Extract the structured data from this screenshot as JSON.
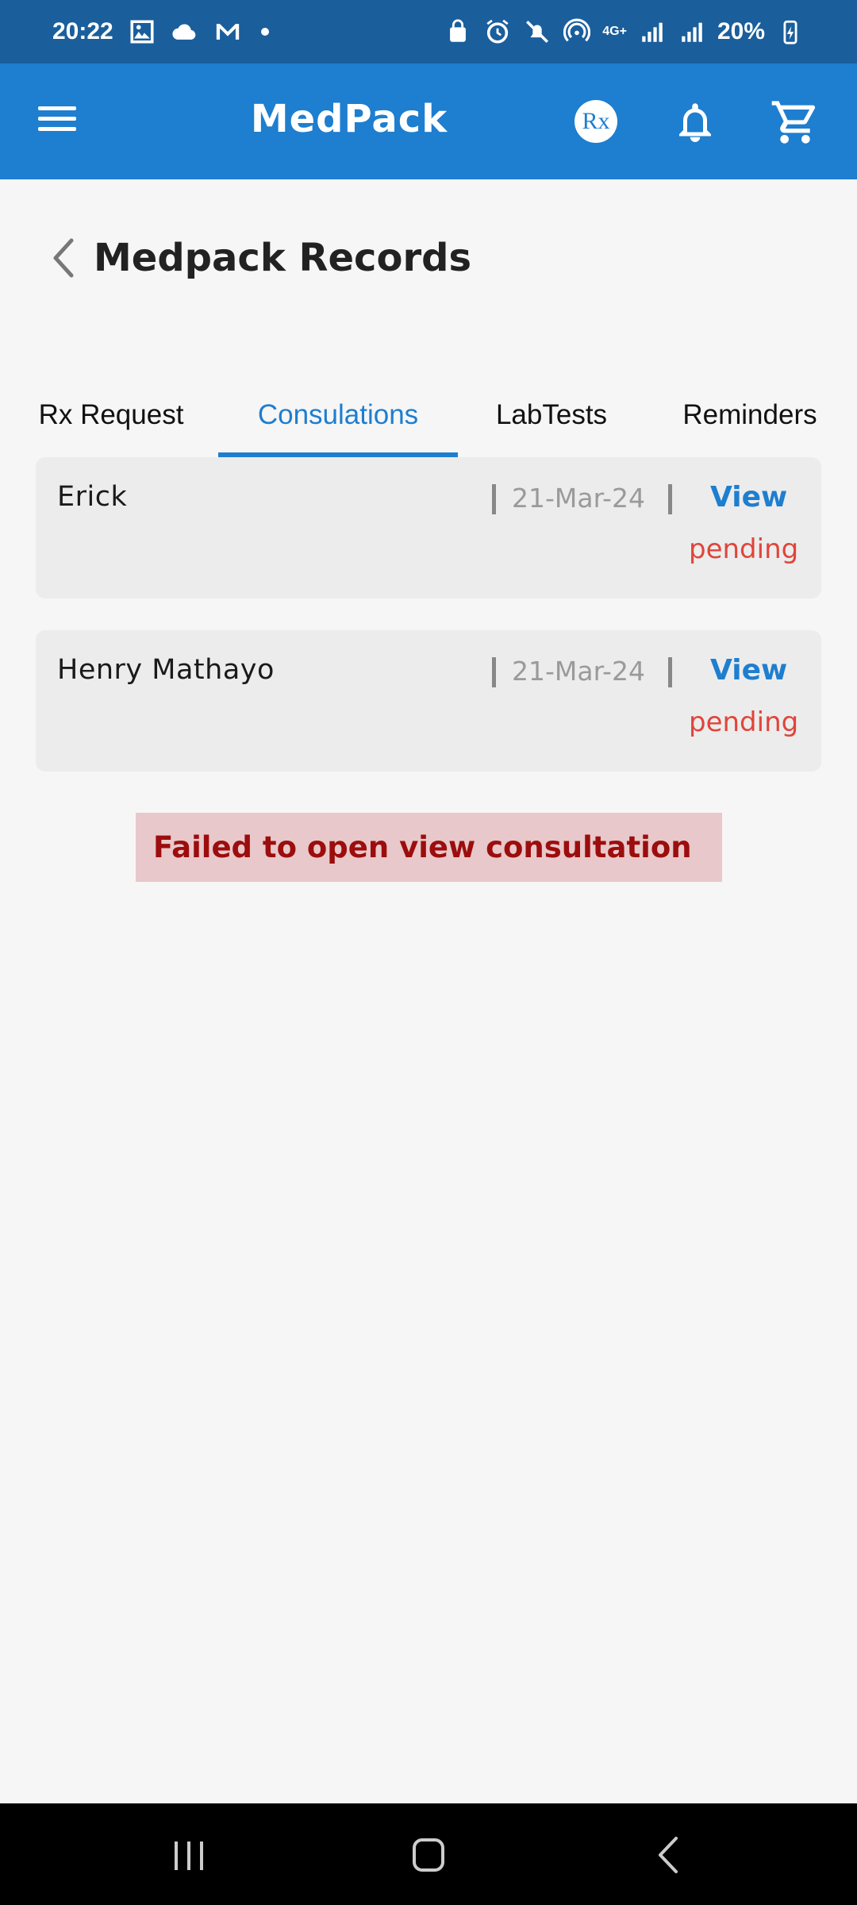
{
  "status_bar": {
    "time": "20:22",
    "network": "4G+",
    "battery": "20%"
  },
  "app_bar": {
    "title": "MedPack",
    "rx_label": "Rx"
  },
  "page": {
    "title": "Medpack Records"
  },
  "tabs": [
    {
      "label": "Rx Request"
    },
    {
      "label": "Consulations"
    },
    {
      "label": "LabTests"
    },
    {
      "label": "Reminders"
    }
  ],
  "active_tab": "Consulations",
  "records": [
    {
      "name": "Erick",
      "date": "21-Mar-24",
      "action": "View",
      "status": "pending"
    },
    {
      "name": "Henry Mathayo",
      "date": "21-Mar-24",
      "action": "View",
      "status": "pending"
    }
  ],
  "toast": {
    "message": "Failed to open view consultation"
  },
  "colors": {
    "primary": "#1e7ecf",
    "status_bar": "#1a5e9c",
    "pending": "#e0453a",
    "toast_bg": "#e8c8ca",
    "toast_text": "#9c0d0d"
  }
}
